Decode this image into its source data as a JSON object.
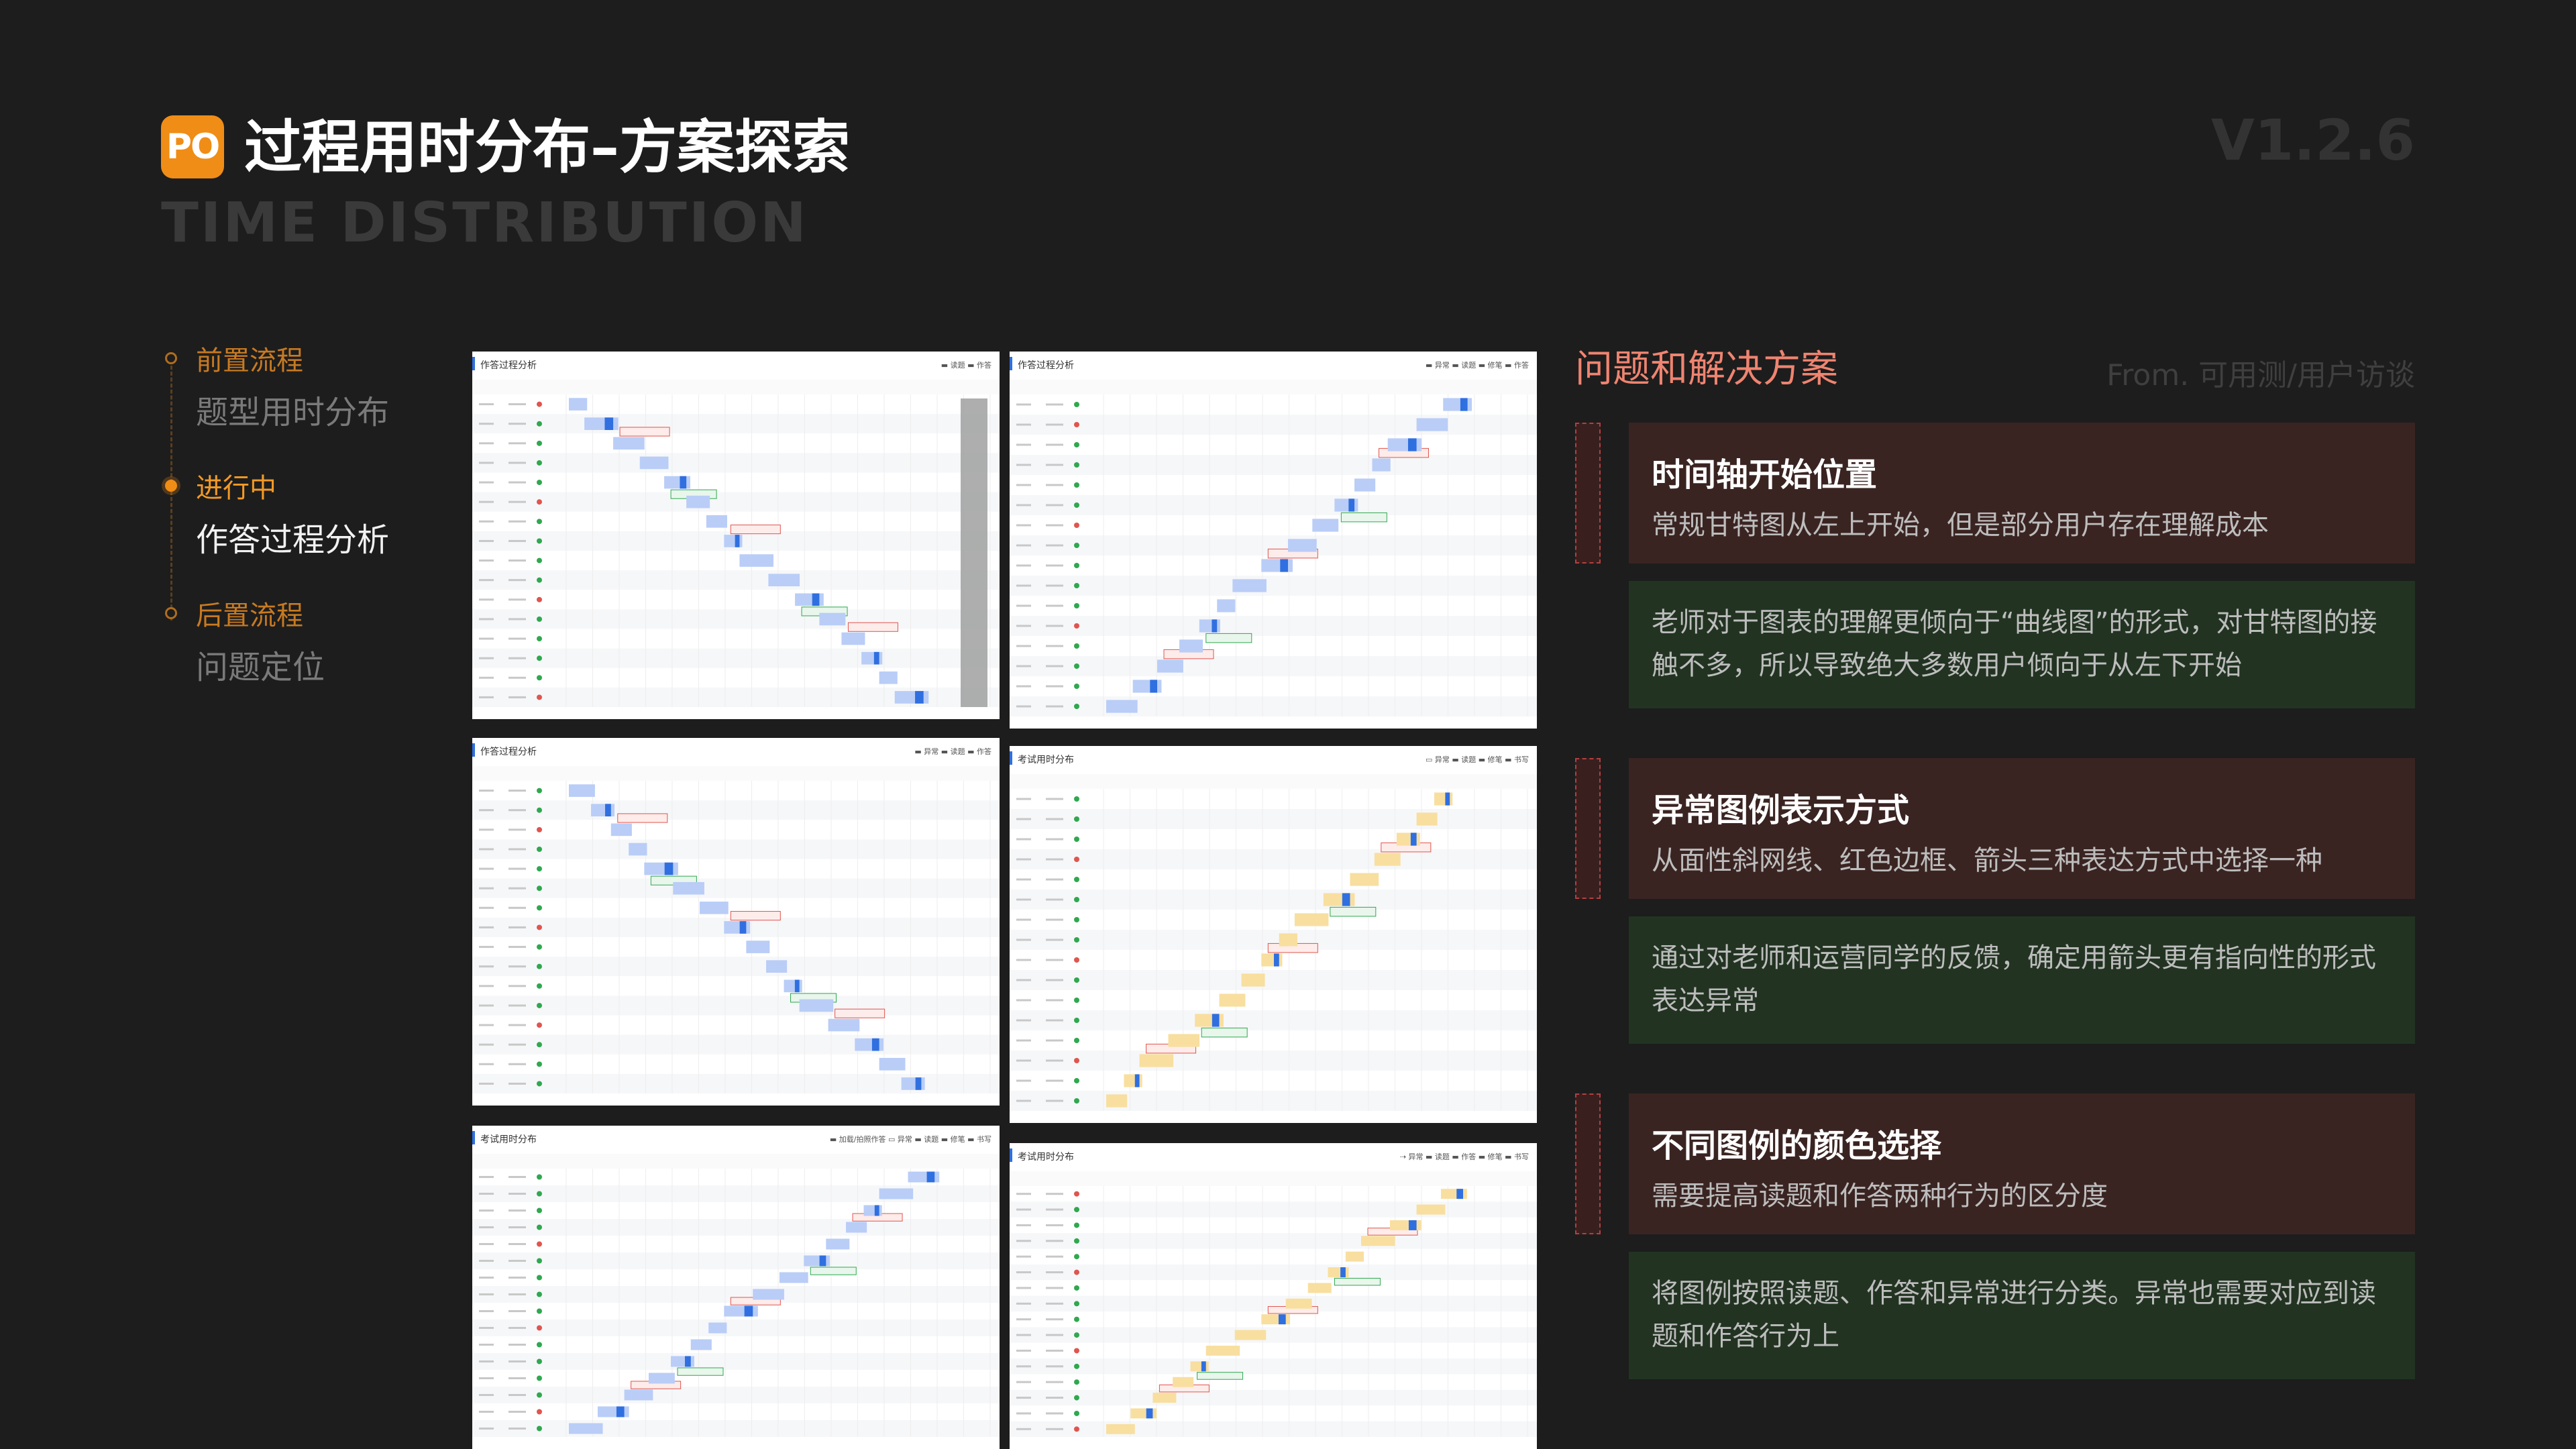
{
  "header": {
    "logo": "PO",
    "title": "过程用时分布–方案探索",
    "subtitle": "TIME DISTRIBUTION",
    "version": "V1.2.6"
  },
  "nav": {
    "items": [
      {
        "head": "前置流程",
        "sub": "题型用时分布",
        "active": false
      },
      {
        "head": "进行中",
        "sub": "作答过程分析",
        "active": true
      },
      {
        "head": "后置流程",
        "sub": "问题定位",
        "active": false
      }
    ]
  },
  "panels": [
    {
      "title": "作答过程分析",
      "legend": "▬ 读题  ▬ 作答"
    },
    {
      "title": "作答过程分析",
      "legend": "▬ 异常  ▬ 读题  ▬ 修笔  ▬ 作答"
    },
    {
      "title": "作答过程分析",
      "legend": "▬ 异常  ▬ 读题  ▬ 作答"
    },
    {
      "title": "考试用时分布",
      "legend": "▭ 异常  ▬ 读题  ▬ 修笔  ▬ 书写"
    },
    {
      "title": "考试用时分布",
      "legend": "▬ 加载/拍照作答  ▭ 异常  ▬ 读题  ▬ 修笔  ▬ 书写"
    },
    {
      "title": "考试用时分布",
      "legend": "⇢ 异常  ▬ 读题  ▬ 作答  ▬ 修笔  ▬ 书写"
    }
  ],
  "right": {
    "heading": "问题和解决方案",
    "source": "From. 可用测/用户访谈",
    "issues": [
      {
        "title": "时间轴开始位置",
        "desc": "常规甘特图从左上开始，但是部分用户存在理解成本",
        "solution": "老师对于图表的理解更倾向于“曲线图”的形式，对甘特图的接触不多，所以导致绝大多数用户倾向于从左下开始"
      },
      {
        "title": "异常图例表示方式",
        "desc": "从面性斜网线、红色边框、箭头三种表达方式中选择一种",
        "solution": "通过对老师和运营同学的反馈，确定用箭头更有指向性的形式表达异常"
      },
      {
        "title": "不同图例的颜色选择",
        "desc": "需要提高读题和作答两种行为的区分度",
        "solution": "将图例按照读题、作答和异常进行分类。异常也需要对应到读题和作答行为上"
      }
    ]
  },
  "colors": {
    "accent": "#f08d16",
    "read": "#b9cdf7",
    "answer": "#2f6fe0",
    "write_yellow": "#f8dfa0",
    "abnormal_red": "#e0554e",
    "pass_green": "#2fa84f"
  }
}
